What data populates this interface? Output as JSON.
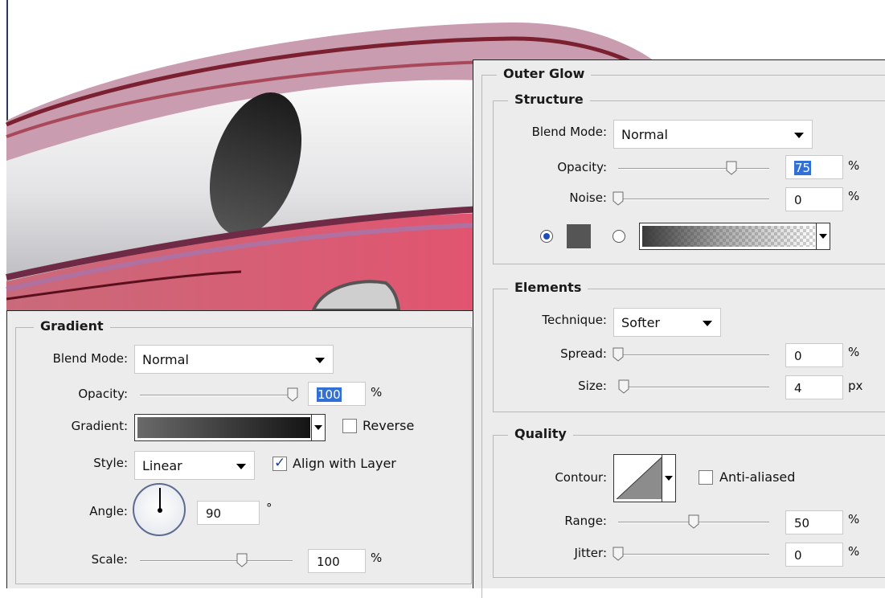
{
  "gradient": {
    "title": "Gradient",
    "blend_mode_label": "Blend Mode:",
    "blend_mode": "Normal",
    "opacity_label": "Opacity:",
    "opacity": "100",
    "opacity_level": 100,
    "opacity_unit": "%",
    "gradient_label": "Gradient:",
    "reverse_label": "Reverse",
    "reverse_checked": false,
    "style_label": "Style:",
    "style": "Linear",
    "align_label": "Align with Layer",
    "align_checked": true,
    "angle_label": "Angle:",
    "angle": "90",
    "angle_unit": "°",
    "scale_label": "Scale:",
    "scale": "100",
    "scale_level": 100,
    "scale_unit": "%"
  },
  "outer_glow": {
    "title": "Outer Glow",
    "structure": {
      "title": "Structure",
      "blend_mode_label": "Blend Mode:",
      "blend_mode": "Normal",
      "opacity_label": "Opacity:",
      "opacity": "75",
      "opacity_level": 75,
      "opacity_unit": "%",
      "noise_label": "Noise:",
      "noise": "0",
      "noise_level": 0,
      "noise_unit": "%",
      "color_swatch": "#555555",
      "glow_type_selected": "color"
    },
    "elements": {
      "title": "Elements",
      "technique_label": "Technique:",
      "technique": "Softer",
      "spread_label": "Spread:",
      "spread": "0",
      "spread_level": 0,
      "spread_unit": "%",
      "size_label": "Size:",
      "size": "4",
      "size_level": 1.6,
      "size_unit": "px"
    },
    "quality": {
      "title": "Quality",
      "contour_label": "Contour:",
      "anti_aliased_label": "Anti-aliased",
      "anti_aliased_checked": false,
      "range_label": "Range:",
      "range": "50",
      "range_level": 50,
      "range_unit": "%",
      "jitter_label": "Jitter:",
      "jitter": "0",
      "jitter_level": 0,
      "jitter_unit": "%"
    }
  }
}
